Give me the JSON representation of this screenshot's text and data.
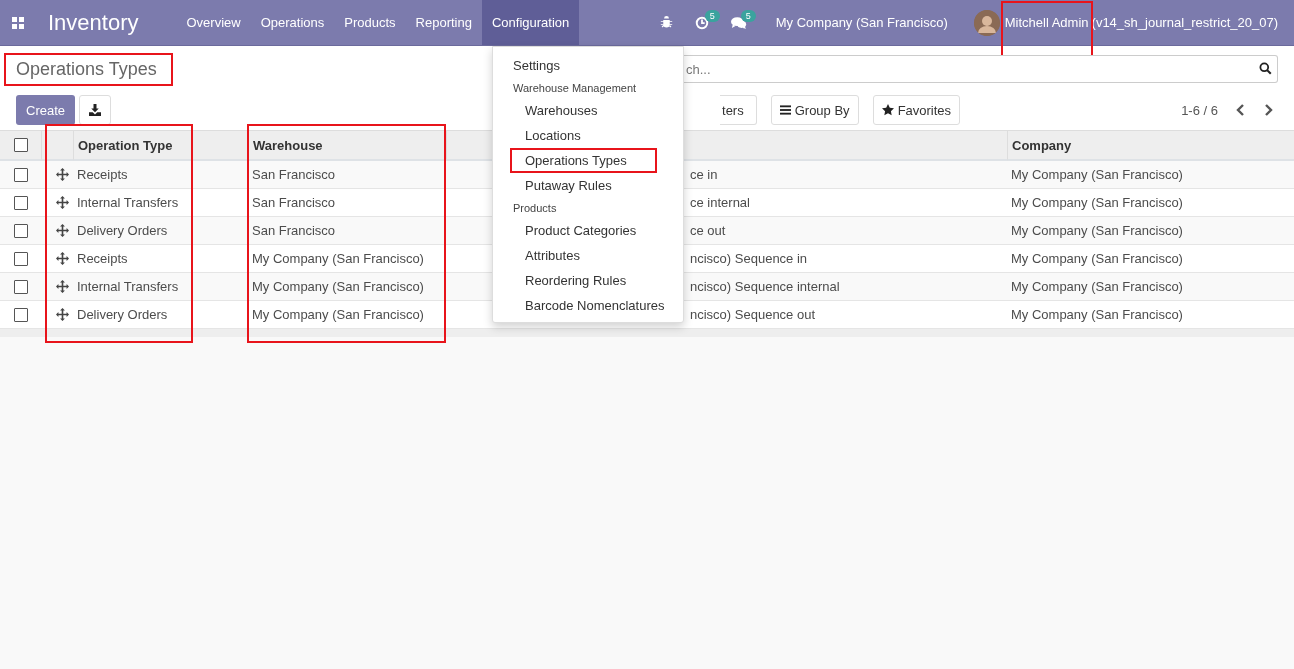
{
  "navbar": {
    "app_name": "Inventory",
    "menu": [
      {
        "label": "Overview",
        "selected": false
      },
      {
        "label": "Operations",
        "selected": false
      },
      {
        "label": "Products",
        "selected": false
      },
      {
        "label": "Reporting",
        "selected": false
      },
      {
        "label": "Configuration",
        "selected": true
      }
    ],
    "activity_badge": "5",
    "message_badge": "5",
    "company": "My Company (San Francisco)",
    "user": {
      "name": "Mitchell Admin",
      "annotated": true,
      "database": "(v14_sh_journal_restrict_20_07)"
    }
  },
  "dropdown": {
    "items": [
      {
        "kind": "item",
        "label": "Settings",
        "annotated": false
      },
      {
        "kind": "section",
        "label": "Warehouse Management"
      },
      {
        "kind": "subitem",
        "label": "Warehouses",
        "annotated": false
      },
      {
        "kind": "subitem",
        "label": "Locations",
        "annotated": false
      },
      {
        "kind": "subitem",
        "label": "Operations Types",
        "annotated": true
      },
      {
        "kind": "subitem",
        "label": "Putaway Rules",
        "annotated": false
      },
      {
        "kind": "section",
        "label": "Products"
      },
      {
        "kind": "subitem",
        "label": "Product Categories",
        "annotated": false
      },
      {
        "kind": "subitem",
        "label": "Attributes",
        "annotated": false
      },
      {
        "kind": "subitem",
        "label": "Reordering Rules",
        "annotated": false
      },
      {
        "kind": "subitem",
        "label": "Barcode Nomenclatures",
        "annotated": false
      }
    ]
  },
  "control_panel": {
    "title": "Operations Types",
    "title_annotated": true,
    "create_button": "Create",
    "search": {
      "placeholder": "ch..."
    },
    "filters_button": "ters",
    "group_by_button": "Group By",
    "favorites_button": "Favorites",
    "pager": "1-6 / 6"
  },
  "table": {
    "select_all_checked": false,
    "columns": [
      {
        "label": "Operation Type",
        "annotated": true
      },
      {
        "label": "Warehouse",
        "annotated": true
      },
      {
        "annotated": false
      },
      {
        "label": "Company",
        "annotated": false
      }
    ],
    "rows": [
      {
        "checked": false,
        "operation_type": "Receipts",
        "warehouse": "San Francisco",
        "column_3": "ce in",
        "company": "My Company (San Francisco)"
      },
      {
        "checked": false,
        "operation_type": "Internal Transfers",
        "warehouse": "San Francisco",
        "column_3": "ce internal",
        "company": "My Company (San Francisco)"
      },
      {
        "checked": false,
        "operation_type": "Delivery Orders",
        "warehouse": "San Francisco",
        "column_3": "ce out",
        "company": "My Company (San Francisco)"
      },
      {
        "checked": false,
        "operation_type": "Receipts",
        "warehouse": "My Company (San Francisco)",
        "column_3": "ncisco) Sequence in",
        "company": "My Company (San Francisco)"
      },
      {
        "checked": false,
        "operation_type": "Internal Transfers",
        "warehouse": "My Company (San Francisco)",
        "column_3": "ncisco) Sequence internal",
        "company": "My Company (San Francisco)"
      },
      {
        "checked": false,
        "operation_type": "Delivery Orders",
        "warehouse": "My Company (San Francisco)",
        "column_3": "ncisco) Sequence out",
        "company": "My Company (San Francisco)"
      }
    ]
  }
}
